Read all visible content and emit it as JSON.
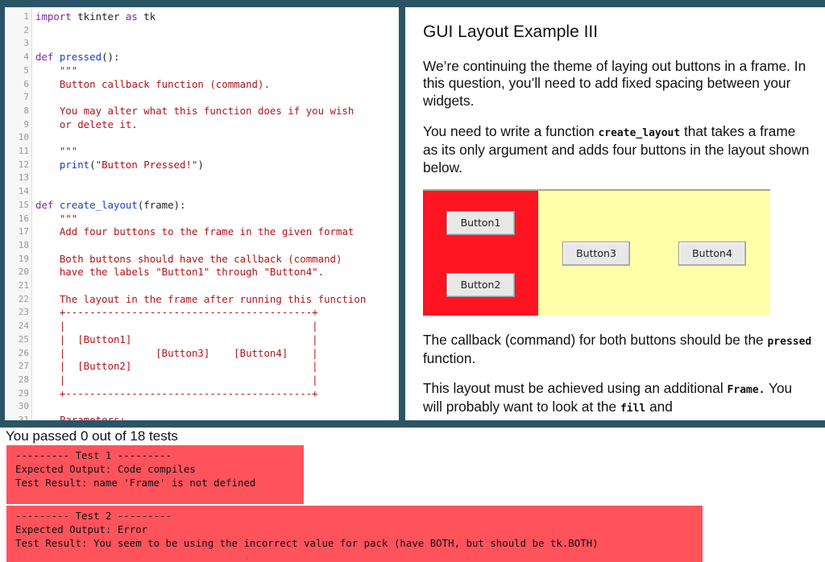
{
  "editor": {
    "line_numbers": [
      "1",
      "2",
      "3",
      "4",
      "5",
      "6",
      "7",
      "8",
      "9",
      "10",
      "11",
      "12",
      "13",
      "14",
      "15",
      "16",
      "17",
      "18",
      "19",
      "20",
      "21",
      "22",
      "23",
      "24",
      "25",
      "26",
      "27",
      "28",
      "29",
      "30",
      "31"
    ],
    "lines": [
      [
        {
          "t": "import",
          "c": "kw"
        },
        {
          "t": " tkinter ",
          "c": "plain"
        },
        {
          "t": "as",
          "c": "kw"
        },
        {
          "t": " tk",
          "c": "plain"
        }
      ],
      [],
      [],
      [
        {
          "t": "def ",
          "c": "kw"
        },
        {
          "t": "pressed",
          "c": "fn"
        },
        {
          "t": "():",
          "c": "plain"
        }
      ],
      [
        {
          "t": "    \"\"\"",
          "c": "str"
        }
      ],
      [
        {
          "t": "    Button callback function (command).",
          "c": "str"
        }
      ],
      [],
      [
        {
          "t": "    You may alter what this function does if you wish",
          "c": "str"
        }
      ],
      [
        {
          "t": "    or delete it.",
          "c": "str"
        }
      ],
      [],
      [
        {
          "t": "    \"\"\"",
          "c": "str"
        }
      ],
      [
        {
          "t": "    print",
          "c": "fn"
        },
        {
          "t": "(",
          "c": "plain"
        },
        {
          "t": "\"Button Pressed!\"",
          "c": "str"
        },
        {
          "t": ")",
          "c": "plain"
        }
      ],
      [],
      [],
      [
        {
          "t": "def ",
          "c": "kw"
        },
        {
          "t": "create_layout",
          "c": "fn"
        },
        {
          "t": "(frame):",
          "c": "plain"
        }
      ],
      [
        {
          "t": "    \"\"\"",
          "c": "str"
        }
      ],
      [
        {
          "t": "    Add four buttons to the frame in the given format",
          "c": "str"
        }
      ],
      [],
      [
        {
          "t": "    Both buttons should have the callback (command)",
          "c": "str"
        }
      ],
      [
        {
          "t": "    have the labels \"Button1\" through \"Button4\".",
          "c": "str"
        }
      ],
      [],
      [
        {
          "t": "    The layout in the frame after running this function",
          "c": "str"
        }
      ],
      [
        {
          "t": "    +-----------------------------------------+",
          "c": "str"
        }
      ],
      [
        {
          "t": "    |                                         |",
          "c": "str"
        }
      ],
      [
        {
          "t": "    |  [Button1]                              |",
          "c": "str"
        }
      ],
      [
        {
          "t": "    |               [Button3]    [Button4]    |",
          "c": "str"
        }
      ],
      [
        {
          "t": "    |  [Button2]                              |",
          "c": "str"
        }
      ],
      [
        {
          "t": "    |                                         |",
          "c": "str"
        }
      ],
      [
        {
          "t": "    +-----------------------------------------+",
          "c": "str"
        }
      ],
      [],
      [
        {
          "t": "    Parameters:",
          "c": "str"
        }
      ]
    ]
  },
  "doc": {
    "title": "GUI Layout Example III",
    "p1": "We’re continuing the theme of laying out buttons in a frame. In this question, you’ll need to add fixed spacing between your widgets.",
    "p2_a": "You need to write a function ",
    "p2_code": "create_layout",
    "p2_b": " that takes a frame as its only argument and adds four buttons in the layout shown below.",
    "example_buttons": [
      "Button1",
      "Button2",
      "Button3",
      "Button4"
    ],
    "p3_a": "The callback (command) for both buttons should be the ",
    "p3_code": "pressed",
    "p3_b": " function.",
    "p4_a": "This layout must be achieved using an additional ",
    "p4_code1": "Frame.",
    "p4_b": " You will probably want to look at the ",
    "p4_code2": "fill",
    "p4_c": " and"
  },
  "results": {
    "summary": "You passed 0 out of 18 tests",
    "tests": [
      {
        "header": "--------- Test 1 ---------",
        "expected": "Expected Output: Code compiles",
        "result": "Test Result: name 'Frame' is not defined"
      },
      {
        "header": "--------- Test 2 ---------",
        "expected": "Expected Output: Error",
        "result": "Test Result: You seem to be using the incorrect value for pack (have BOTH, but should be tk.BOTH)"
      }
    ]
  },
  "colors": {
    "frame": "#2b5566",
    "test_fail": "#ff535c",
    "example_red": "#ff1421",
    "example_yellow": "#ffffaa"
  }
}
